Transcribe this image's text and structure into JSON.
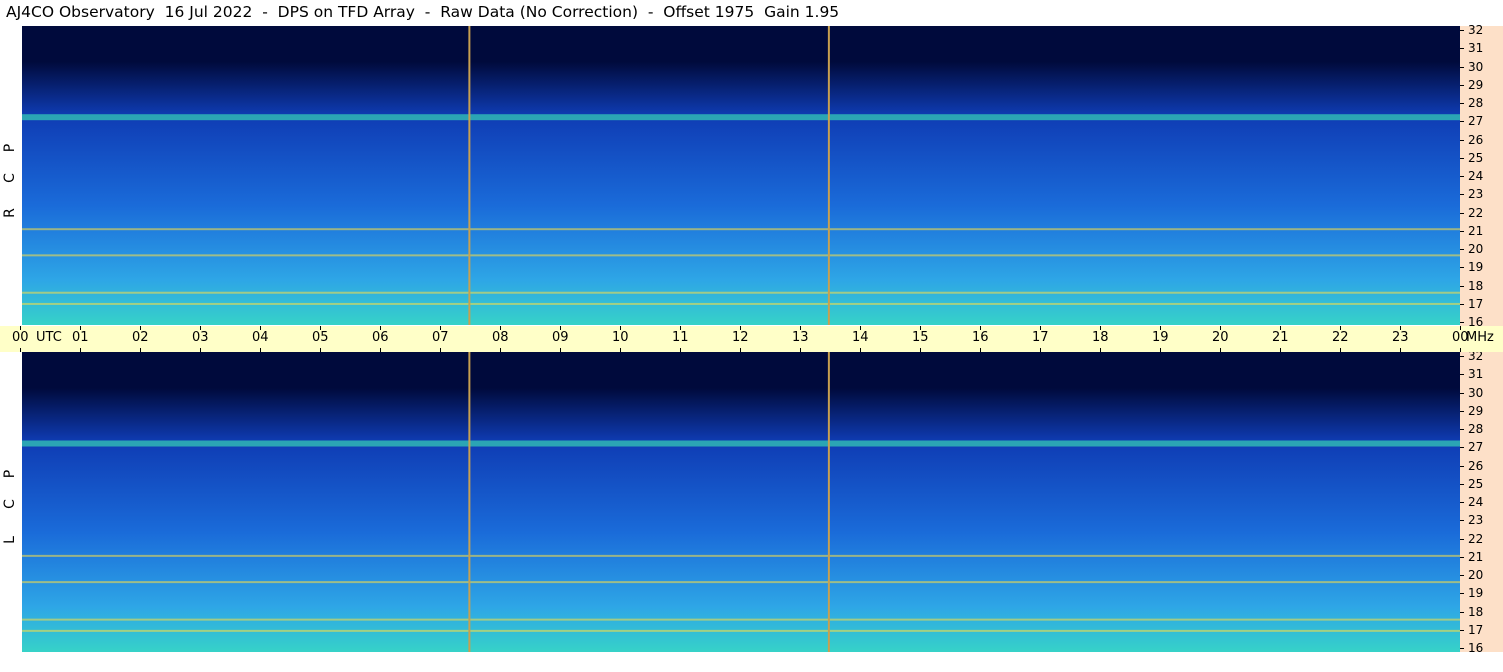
{
  "title": "AJ4CO Observatory  16 Jul 2022  -  DPS on TFD Array  -  Raw Data (No Correction)  -  Offset 1975  Gain 1.95",
  "chart_data": {
    "type": "heatmap",
    "title": "AJ4CO Observatory  16 Jul 2022  -  DPS on TFD Array  -  Raw Data (No Correction)  -  Offset 1975  Gain 1.95",
    "x_axis": {
      "unit_label": "UTC",
      "ticks": [
        "00",
        "01",
        "02",
        "03",
        "04",
        "05",
        "06",
        "07",
        "08",
        "09",
        "10",
        "11",
        "12",
        "13",
        "14",
        "15",
        "16",
        "17",
        "18",
        "19",
        "20",
        "21",
        "22",
        "23",
        "00"
      ],
      "range_hours": [
        0,
        24
      ]
    },
    "y_axis": {
      "unit_label": "MHz",
      "ticks": [
        16,
        17,
        18,
        19,
        20,
        21,
        22,
        23,
        24,
        25,
        26,
        27,
        28,
        29,
        30,
        31,
        32
      ],
      "range_mhz": [
        16,
        32
      ]
    },
    "panels": [
      {
        "name": "RCP",
        "letters": [
          "R",
          "C",
          "P"
        ]
      },
      {
        "name": "LCP",
        "letters": [
          "L",
          "C",
          "P"
        ]
      }
    ],
    "markers_utc_hours": [
      7.45,
      13.45
    ],
    "emission_bands_mhz": [
      17.1,
      17.7,
      19.7,
      21.1,
      27.2
    ],
    "colors": {
      "background_low": "#000a3c",
      "mid": "#1a6bd9",
      "high": "#36d2c8",
      "peak": "#ffe040",
      "marker_line": "#c8a050",
      "time_axis_bg": "#ffffc8",
      "freq_axis_bg": "#fde0c8"
    }
  }
}
